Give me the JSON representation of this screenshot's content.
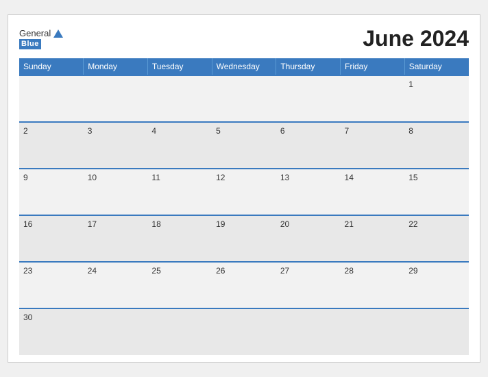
{
  "header": {
    "logo_general": "General",
    "logo_blue": "Blue",
    "title": "June 2024"
  },
  "weekdays": [
    "Sunday",
    "Monday",
    "Tuesday",
    "Wednesday",
    "Thursday",
    "Friday",
    "Saturday"
  ],
  "weeks": [
    [
      "",
      "",
      "",
      "",
      "",
      "",
      "1"
    ],
    [
      "2",
      "3",
      "4",
      "5",
      "6",
      "7",
      "8"
    ],
    [
      "9",
      "10",
      "11",
      "12",
      "13",
      "14",
      "15"
    ],
    [
      "16",
      "17",
      "18",
      "19",
      "20",
      "21",
      "22"
    ],
    [
      "23",
      "24",
      "25",
      "26",
      "27",
      "28",
      "29"
    ],
    [
      "30",
      "",
      "",
      "",
      "",
      "",
      ""
    ]
  ]
}
